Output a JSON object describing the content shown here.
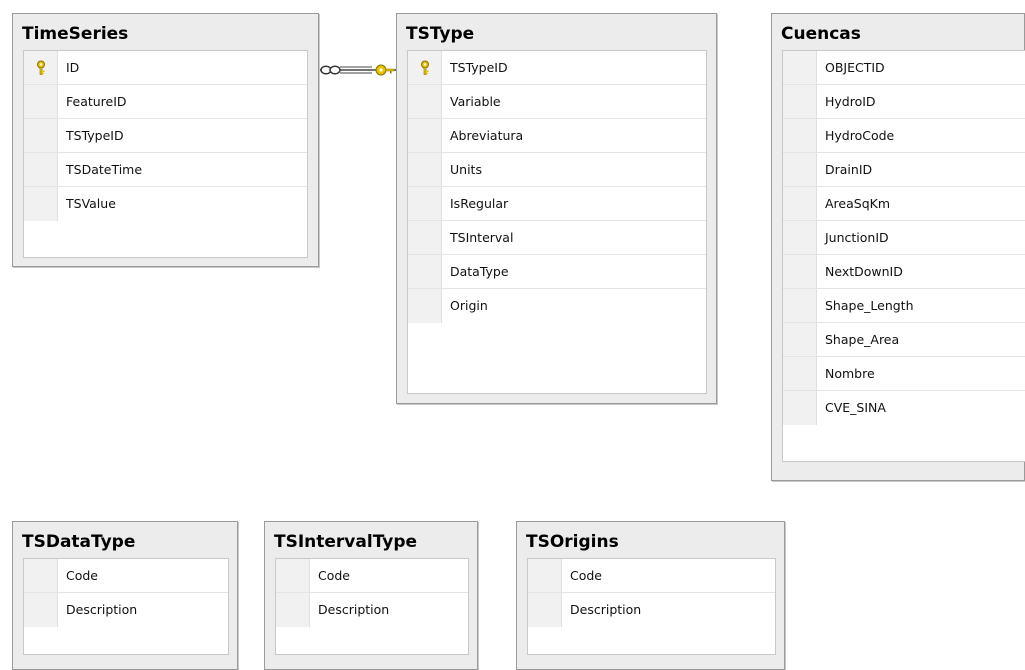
{
  "tables": [
    {
      "name": "TimeSeries",
      "columns": [
        {
          "name": "ID",
          "primary_key": true
        },
        {
          "name": "FeatureID"
        },
        {
          "name": "TSTypeID"
        },
        {
          "name": "TSDateTime"
        },
        {
          "name": "TSValue"
        }
      ]
    },
    {
      "name": "TSType",
      "columns": [
        {
          "name": "TSTypeID",
          "primary_key": true
        },
        {
          "name": "Variable"
        },
        {
          "name": "Abreviatura"
        },
        {
          "name": "Units"
        },
        {
          "name": "IsRegular"
        },
        {
          "name": "TSInterval"
        },
        {
          "name": "DataType"
        },
        {
          "name": "Origin"
        }
      ]
    },
    {
      "name": "Cuencas",
      "columns": [
        {
          "name": "OBJECTID"
        },
        {
          "name": "HydroID"
        },
        {
          "name": "HydroCode"
        },
        {
          "name": "DrainID"
        },
        {
          "name": "AreaSqKm"
        },
        {
          "name": "JunctionID"
        },
        {
          "name": "NextDownID"
        },
        {
          "name": "Shape_Length"
        },
        {
          "name": "Shape_Area"
        },
        {
          "name": "Nombre"
        },
        {
          "name": "CVE_SINA"
        }
      ]
    },
    {
      "name": "TSDataType",
      "columns": [
        {
          "name": "Code"
        },
        {
          "name": "Description"
        }
      ]
    },
    {
      "name": "TSIntervalType",
      "columns": [
        {
          "name": "Code"
        },
        {
          "name": "Description"
        }
      ]
    },
    {
      "name": "TSOrigins",
      "columns": [
        {
          "name": "Code"
        },
        {
          "name": "Description"
        }
      ]
    }
  ],
  "relationships": [
    {
      "from_table": "TimeSeries",
      "from_end": "many",
      "to_table": "TSType",
      "to_end": "one"
    }
  ],
  "colors": {
    "table_background": "#ececec",
    "table_border": "#9a9a9a",
    "key_icon": "#e6c200",
    "relationship_line": "#444444"
  }
}
